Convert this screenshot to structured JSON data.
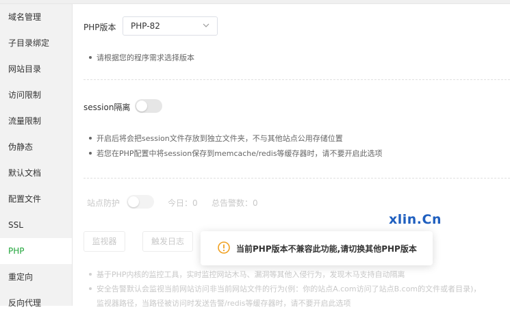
{
  "sidebar": {
    "items": [
      {
        "label": "域名管理"
      },
      {
        "label": "子目录绑定"
      },
      {
        "label": "网站目录"
      },
      {
        "label": "访问限制"
      },
      {
        "label": "流量限制"
      },
      {
        "label": "伪静态"
      },
      {
        "label": "默认文档"
      },
      {
        "label": "配置文件"
      },
      {
        "label": "SSL"
      },
      {
        "label": "PHP"
      },
      {
        "label": "重定向"
      },
      {
        "label": "反向代理"
      }
    ],
    "active": "PHP"
  },
  "php": {
    "label": "PHP版本",
    "selected": "PHP-82",
    "tip": "请根据您的程序需求选择版本"
  },
  "session": {
    "label": "session隔离",
    "enabled": false,
    "tips": [
      "开启后将会把session文件存放到独立文件夹，不与其他站点公用存储位置",
      "若您在PHP配置中将session保存到memcache/redis等缓存器时，请不要开启此选项"
    ]
  },
  "protection": {
    "label": "站点防护",
    "enabled": false,
    "today": "今日：0",
    "total": "总告警数：0",
    "monitor_button": "监视器",
    "log_button": "触发日志",
    "tips": [
      "基于PHP内核的监控工具，实时监控网站木马、漏洞等其他入侵行为，发现木马支持自动隔离",
      "安全告警默认会监视当前网站访问非当前网站文件的行为(例：你的站点A.com访问了站点B.com的文件或者目录)，",
      "监视器路径，当路径被访问时发送告警/redis等缓存器时，请不要开启此选项"
    ]
  },
  "toast": {
    "icon": "warning-icon",
    "message": "当前PHP版本不兼容此功能,请切换其他PHP版本"
  },
  "watermark": "xlin.Cn",
  "colors": {
    "accent": "#20a53a",
    "warning": "#f0a020",
    "watermark": "#1f5fbf"
  }
}
